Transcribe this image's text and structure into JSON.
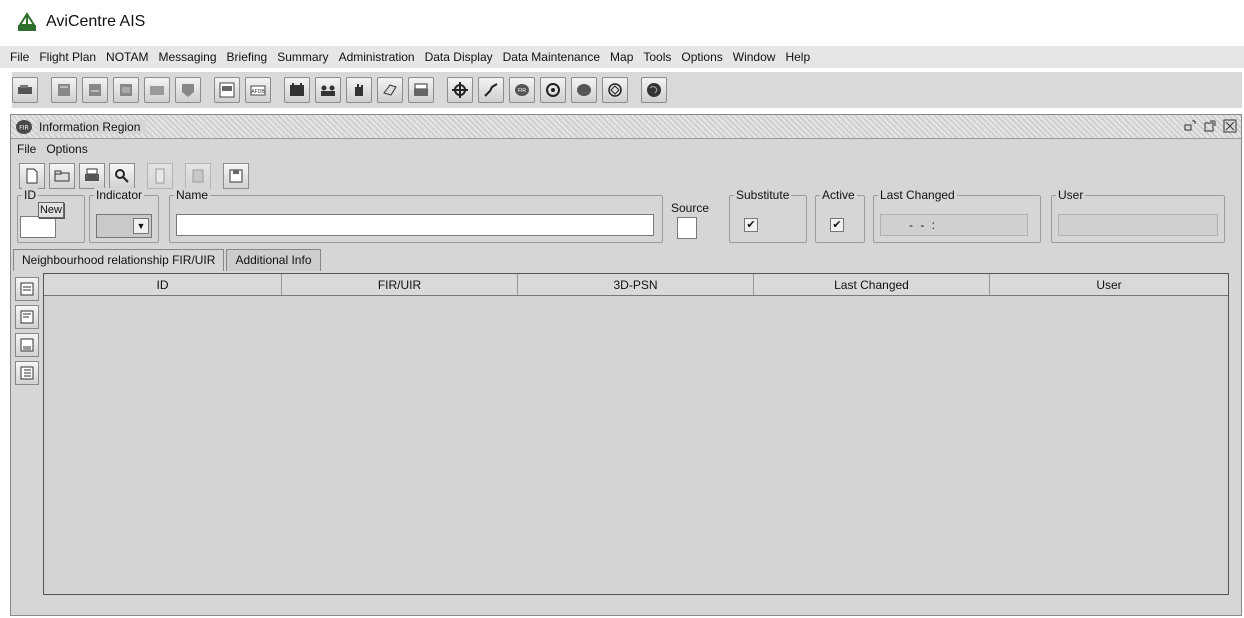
{
  "app": {
    "title": "AviCentre AIS"
  },
  "menubar": [
    "File",
    "Flight Plan",
    "NOTAM",
    "Messaging",
    "Briefing",
    "Summary",
    "Administration",
    "Data Display",
    "Data Maintenance",
    "Map",
    "Tools",
    "Options",
    "Window",
    "Help"
  ],
  "toolbar_icons": [
    "flight-plan-icon",
    "notam-icon",
    "message-icon",
    "message-in-icon",
    "message-out-icon",
    "message-archive-icon",
    "briefing-icon",
    "afdb-icon",
    "calendar-icon",
    "users-icon",
    "hand-icon",
    "eraser-icon",
    "printer-stack-icon",
    "waypoint-icon",
    "route-icon",
    "fir-icon",
    "circle-icon",
    "region-icon",
    "navaid-icon",
    "globe-icon"
  ],
  "window": {
    "title": "Information Region",
    "icon_label": "FIR",
    "menu": [
      "File",
      "Options"
    ]
  },
  "form": {
    "id_label": "ID",
    "new_label": "New",
    "indicator_label": "Indicator",
    "name_label": "Name",
    "source_label": "Source",
    "substitute_label": "Substitute",
    "active_label": "Active",
    "last_changed_label": "Last Changed",
    "last_changed_value": "- -     :",
    "user_label": "User",
    "substitute_checked": "✔",
    "active_checked": "✔"
  },
  "tabs": [
    "Neighbourhood relationship FIR/UIR",
    "Additional Info"
  ],
  "table": {
    "columns": [
      "ID",
      "FIR/UIR",
      "3D-PSN",
      "Last Changed",
      "User"
    ]
  }
}
